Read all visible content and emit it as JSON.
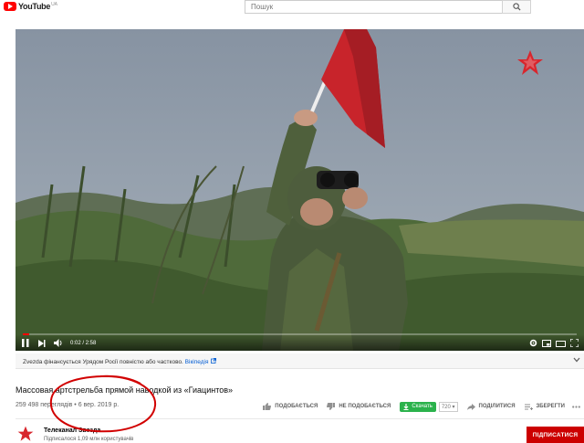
{
  "header": {
    "logo_text": "YouTube",
    "region": "UA",
    "search_placeholder": "Пошук",
    "search_icon": "search-icon"
  },
  "player": {
    "current_time": "0:02",
    "duration": "2:58",
    "time_display": "0:02 / 2:58",
    "progress": 0.011,
    "channel_watermark": "star-icon"
  },
  "info_bar": {
    "text": "Zvezda фінансується Урядом Росії повністю або частково. ",
    "link": "Вікіпедія",
    "link_icon": "external-link-icon"
  },
  "video": {
    "title": "Массовая артстрельба прямой наводкой из «Гиацинтов»",
    "views_date": "259 498 переглядів • 6 вер. 2019 р."
  },
  "actions": {
    "like": "ПОДОБАЄТЬСЯ",
    "dislike": "НЕ ПОДОБАЄТЬСЯ",
    "download": "Скачать",
    "quality": "720",
    "share": "ПОДІЛИТИСЯ",
    "save": "ЗБЕРЕГТИ"
  },
  "channel": {
    "name": "Телеканал Звезда",
    "subscribers": "Підписалося 1,09 млн користувачів",
    "subscribe_label": "ПІДПИСАТИСЯ"
  },
  "colors": {
    "brand_red": "#ff0000",
    "subscribe_red": "#cc0000",
    "download_green": "#2bb24c",
    "link_blue": "#065fd4",
    "annotation_red": "#d10000"
  }
}
